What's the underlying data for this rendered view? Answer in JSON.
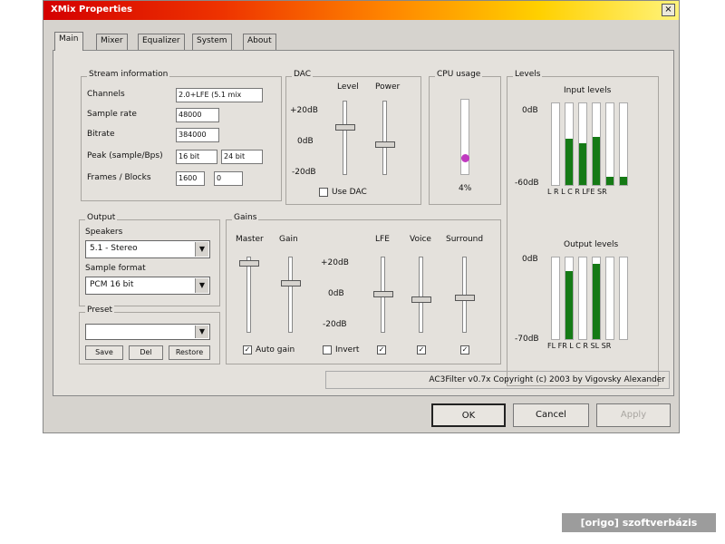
{
  "window": {
    "title": "XMix Properties",
    "close_glyph": "×"
  },
  "tabs": [
    {
      "label": "Main",
      "active": true
    },
    {
      "label": "Mixer"
    },
    {
      "label": "Equalizer"
    },
    {
      "label": "System"
    },
    {
      "label": "About"
    }
  ],
  "stream_info": {
    "title": "Stream information",
    "rows": [
      {
        "label": "Channels",
        "value": "2.0+LFE (5.1 mix"
      },
      {
        "label": "Sample rate",
        "value": "48000"
      },
      {
        "label": "Bitrate",
        "value": "384000"
      },
      {
        "label": "Peak (sample/Bps)",
        "value": "16 bit",
        "value2": "24 bit"
      },
      {
        "label": "Frames / Blocks",
        "value": "1600",
        "value2": "0"
      }
    ]
  },
  "dac": {
    "title": "DAC",
    "col_level": "Level",
    "col_power": "Power",
    "ticks": [
      "+20dB",
      "0dB",
      "-20dB"
    ],
    "use_dac_label": "Use DAC",
    "level_pos": 0.35,
    "power_pos": 0.6
  },
  "cpu": {
    "title": "CPU usage",
    "value": "4%",
    "level": 0.04
  },
  "levels": {
    "title": "Levels",
    "input": {
      "title": "Input levels",
      "top": "0dB",
      "bottom": "-60dB",
      "channel_labels": "L R L C R LFE SR",
      "values": [
        0,
        0.55,
        0.5,
        0.58,
        0.1,
        0.1
      ]
    },
    "output": {
      "title": "Output levels",
      "top": "0dB",
      "bottom": "-70dB",
      "channel_labels": "FL FR L C R SL SR",
      "values": [
        0,
        0.82,
        0,
        0.9,
        0,
        0
      ]
    }
  },
  "output": {
    "title": "Output",
    "speakers_label": "Speakers",
    "speakers_value": "5.1 - Stereo",
    "format_label": "Sample format",
    "format_value": "PCM 16 bit",
    "arrow": "▼"
  },
  "preset": {
    "title": "Preset",
    "value": "",
    "arrow": "▼",
    "buttons": [
      "Save",
      "Del",
      "Restore"
    ]
  },
  "gains": {
    "title": "Gains",
    "master": "Master",
    "gain": "Gain",
    "ticks": [
      "+20dB",
      "0dB",
      "-20dB"
    ],
    "lfe": "LFE",
    "voice": "Voice",
    "surround": "Surround",
    "check_auto": "Auto gain",
    "check_invert": "Invert",
    "check_glyph": "✓"
  },
  "status": {
    "text": "AC3Filter v0.7x Copyright (c) 2003 by Vigovsky Alexander"
  },
  "buttons": {
    "ok": "OK",
    "cancel": "Cancel",
    "apply": "Apply"
  },
  "watermark": "[origo] szoftverbázis"
}
